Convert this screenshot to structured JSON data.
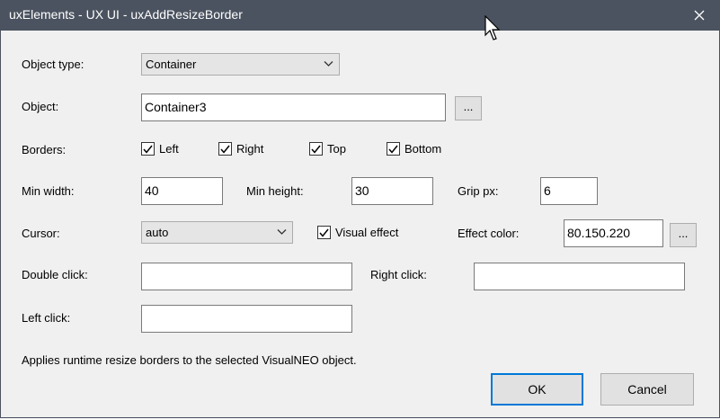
{
  "window": {
    "title": "uxElements - UX UI - uxAddResizeBorder"
  },
  "fields": {
    "object_type": {
      "label": "Object type:",
      "value": "Container"
    },
    "object": {
      "label": "Object:",
      "value": "Container3",
      "browse_label": "..."
    },
    "borders": {
      "label": "Borders:",
      "items": [
        {
          "label": "Left",
          "checked": true
        },
        {
          "label": "Right",
          "checked": true
        },
        {
          "label": "Top",
          "checked": true
        },
        {
          "label": "Bottom",
          "checked": true
        }
      ]
    },
    "min_width": {
      "label": "Min width:",
      "value": "40"
    },
    "min_height": {
      "label": "Min height:",
      "value": "30"
    },
    "grip_px": {
      "label": "Grip px:",
      "value": "6"
    },
    "cursor": {
      "label": "Cursor:",
      "value": "auto"
    },
    "visual_effect": {
      "label": "Visual effect",
      "checked": true
    },
    "effect_color": {
      "label": "Effect color:",
      "value": "80.150.220",
      "browse_label": "..."
    },
    "double_click": {
      "label": "Double click:",
      "value": ""
    },
    "right_click": {
      "label": "Right click:",
      "value": ""
    },
    "left_click": {
      "label": "Left click:",
      "value": ""
    }
  },
  "description": "Applies runtime resize borders to the selected VisualNEO object.",
  "buttons": {
    "ok": "OK",
    "cancel": "Cancel"
  },
  "colors": {
    "titlebar": "#4b5360",
    "dialog_bg": "#f0f0f0",
    "focus_border": "#0078d7"
  }
}
